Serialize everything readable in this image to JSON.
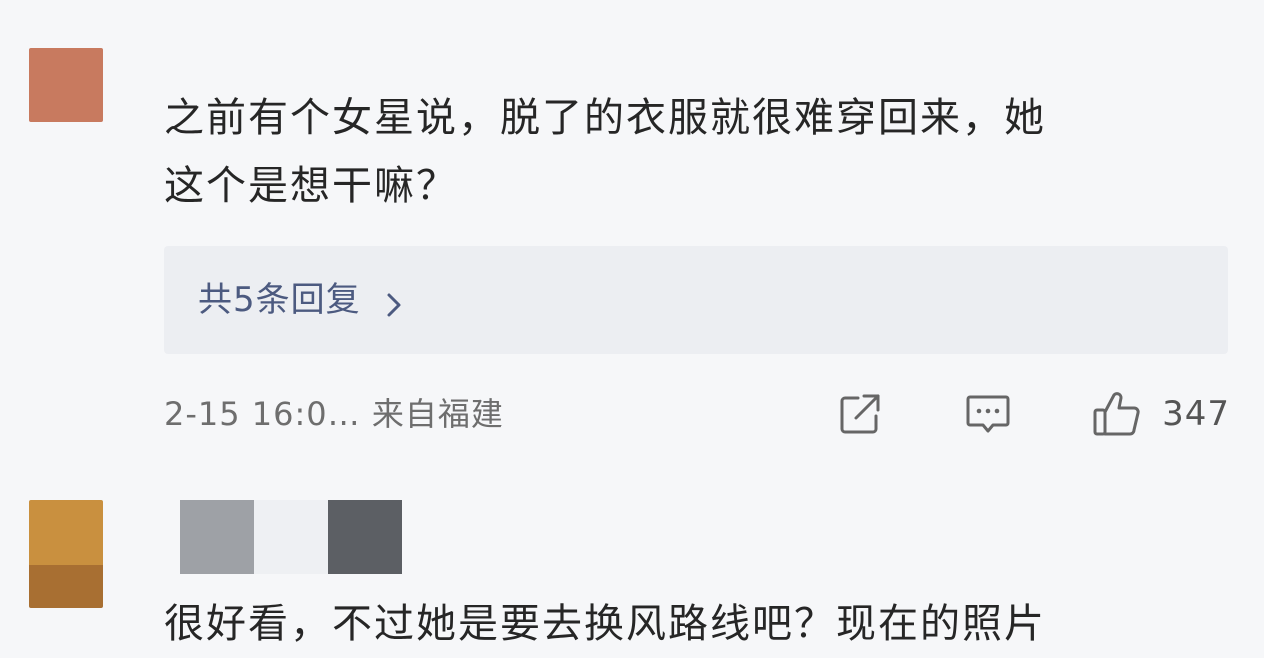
{
  "comments": [
    {
      "text_line1": "之前有个女星说，脱了的衣服就很难穿回来，她",
      "text_line2": "这个是想干嘛？",
      "reply_link": "共5条回复",
      "meta": "2-15 16:0… 来自福建",
      "like_count": "347"
    },
    {
      "text_partial": "很好看，不过她是要去换风路线吧？现在的照片"
    }
  ],
  "icons": {
    "share": "share-icon",
    "reply": "comment-icon",
    "like": "thumbs-up-icon",
    "chevron": "chevron-right-icon"
  }
}
